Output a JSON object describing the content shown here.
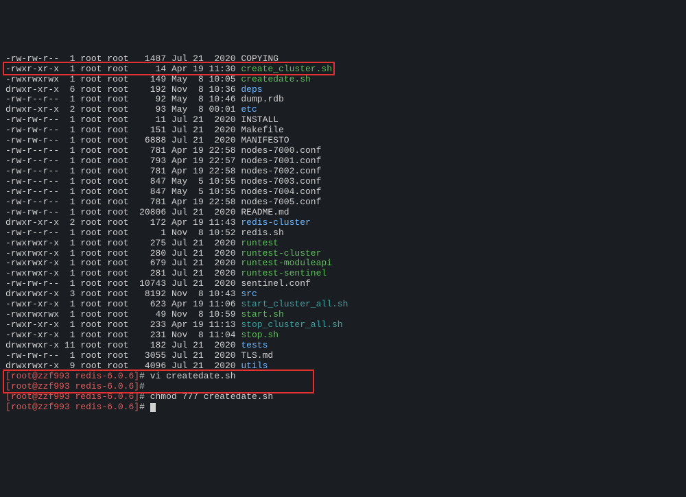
{
  "listing": [
    {
      "perm": "-rw-rw-r--",
      "l": " 1",
      "o": "root",
      "g": "root",
      "sz": "  1487",
      "date": "Jul 21  2020",
      "name": "COPYING",
      "cls": "plain"
    },
    {
      "perm": "-rwxr-xr-x",
      "l": " 1",
      "o": "root",
      "g": "root",
      "sz": "    14",
      "date": "Apr 19 11:30",
      "name": "create_cluster.sh",
      "cls": "exec"
    },
    {
      "perm": "-rwxrwxrwx",
      "l": " 1",
      "o": "root",
      "g": "root",
      "sz": "   149",
      "date": "May  8 10:05",
      "name": "createdate.sh",
      "cls": "exec"
    },
    {
      "perm": "drwxr-xr-x",
      "l": " 6",
      "o": "root",
      "g": "root",
      "sz": "   192",
      "date": "Nov  8 10:36",
      "name": "deps",
      "cls": "dir"
    },
    {
      "perm": "-rw-r--r--",
      "l": " 1",
      "o": "root",
      "g": "root",
      "sz": "    92",
      "date": "May  8 10:46",
      "name": "dump.rdb",
      "cls": "plain"
    },
    {
      "perm": "drwxr-xr-x",
      "l": " 2",
      "o": "root",
      "g": "root",
      "sz": "    93",
      "date": "May  8 00:01",
      "name": "etc",
      "cls": "dir"
    },
    {
      "perm": "-rw-rw-r--",
      "l": " 1",
      "o": "root",
      "g": "root",
      "sz": "    11",
      "date": "Jul 21  2020",
      "name": "INSTALL",
      "cls": "plain"
    },
    {
      "perm": "-rw-rw-r--",
      "l": " 1",
      "o": "root",
      "g": "root",
      "sz": "   151",
      "date": "Jul 21  2020",
      "name": "Makefile",
      "cls": "plain"
    },
    {
      "perm": "-rw-rw-r--",
      "l": " 1",
      "o": "root",
      "g": "root",
      "sz": "  6888",
      "date": "Jul 21  2020",
      "name": "MANIFESTO",
      "cls": "plain"
    },
    {
      "perm": "-rw-r--r--",
      "l": " 1",
      "o": "root",
      "g": "root",
      "sz": "   781",
      "date": "Apr 19 22:58",
      "name": "nodes-7000.conf",
      "cls": "plain"
    },
    {
      "perm": "-rw-r--r--",
      "l": " 1",
      "o": "root",
      "g": "root",
      "sz": "   793",
      "date": "Apr 19 22:57",
      "name": "nodes-7001.conf",
      "cls": "plain"
    },
    {
      "perm": "-rw-r--r--",
      "l": " 1",
      "o": "root",
      "g": "root",
      "sz": "   781",
      "date": "Apr 19 22:58",
      "name": "nodes-7002.conf",
      "cls": "plain"
    },
    {
      "perm": "-rw-r--r--",
      "l": " 1",
      "o": "root",
      "g": "root",
      "sz": "   847",
      "date": "May  5 10:55",
      "name": "nodes-7003.conf",
      "cls": "plain"
    },
    {
      "perm": "-rw-r--r--",
      "l": " 1",
      "o": "root",
      "g": "root",
      "sz": "   847",
      "date": "May  5 10:55",
      "name": "nodes-7004.conf",
      "cls": "plain"
    },
    {
      "perm": "-rw-r--r--",
      "l": " 1",
      "o": "root",
      "g": "root",
      "sz": "   781",
      "date": "Apr 19 22:58",
      "name": "nodes-7005.conf",
      "cls": "plain"
    },
    {
      "perm": "-rw-rw-r--",
      "l": " 1",
      "o": "root",
      "g": "root",
      "sz": " 20806",
      "date": "Jul 21  2020",
      "name": "README.md",
      "cls": "plain"
    },
    {
      "perm": "drwxr-xr-x",
      "l": " 2",
      "o": "root",
      "g": "root",
      "sz": "   172",
      "date": "Apr 19 11:43",
      "name": "redis-cluster",
      "cls": "dir"
    },
    {
      "perm": "-rw-r--r--",
      "l": " 1",
      "o": "root",
      "g": "root",
      "sz": "     1",
      "date": "Nov  8 10:52",
      "name": "redis.sh",
      "cls": "plain"
    },
    {
      "perm": "-rwxrwxr-x",
      "l": " 1",
      "o": "root",
      "g": "root",
      "sz": "   275",
      "date": "Jul 21  2020",
      "name": "runtest",
      "cls": "exec"
    },
    {
      "perm": "-rwxrwxr-x",
      "l": " 1",
      "o": "root",
      "g": "root",
      "sz": "   280",
      "date": "Jul 21  2020",
      "name": "runtest-cluster",
      "cls": "exec"
    },
    {
      "perm": "-rwxrwxr-x",
      "l": " 1",
      "o": "root",
      "g": "root",
      "sz": "   679",
      "date": "Jul 21  2020",
      "name": "runtest-moduleapi",
      "cls": "exec"
    },
    {
      "perm": "-rwxrwxr-x",
      "l": " 1",
      "o": "root",
      "g": "root",
      "sz": "   281",
      "date": "Jul 21  2020",
      "name": "runtest-sentinel",
      "cls": "exec"
    },
    {
      "perm": "-rw-rw-r--",
      "l": " 1",
      "o": "root",
      "g": "root",
      "sz": " 10743",
      "date": "Jul 21  2020",
      "name": "sentinel.conf",
      "cls": "plain"
    },
    {
      "perm": "drwxrwxr-x",
      "l": " 3",
      "o": "root",
      "g": "root",
      "sz": "  8192",
      "date": "Nov  8 10:43",
      "name": "src",
      "cls": "dir"
    },
    {
      "perm": "-rwxr-xr-x",
      "l": " 1",
      "o": "root",
      "g": "root",
      "sz": "   623",
      "date": "Apr 19 11:06",
      "name": "start_cluster_all.sh",
      "cls": "exec-cyan"
    },
    {
      "perm": "-rwxrwxrwx",
      "l": " 1",
      "o": "root",
      "g": "root",
      "sz": "    49",
      "date": "Nov  8 10:59",
      "name": "start.sh",
      "cls": "exec"
    },
    {
      "perm": "-rwxr-xr-x",
      "l": " 1",
      "o": "root",
      "g": "root",
      "sz": "   233",
      "date": "Apr 19 11:13",
      "name": "stop_cluster_all.sh",
      "cls": "exec-cyan"
    },
    {
      "perm": "-rwxr-xr-x",
      "l": " 1",
      "o": "root",
      "g": "root",
      "sz": "   231",
      "date": "Nov  8 11:04",
      "name": "stop.sh",
      "cls": "exec"
    },
    {
      "perm": "drwxrwxr-x",
      "l": "11",
      "o": "root",
      "g": "root",
      "sz": "   182",
      "date": "Jul 21  2020",
      "name": "tests",
      "cls": "dir"
    },
    {
      "perm": "-rw-rw-r--",
      "l": " 1",
      "o": "root",
      "g": "root",
      "sz": "  3055",
      "date": "Jul 21  2020",
      "name": "TLS.md",
      "cls": "plain"
    },
    {
      "perm": "drwxrwxr-x",
      "l": " 9",
      "o": "root",
      "g": "root",
      "sz": "  4096",
      "date": "Jul 21  2020",
      "name": "utils",
      "cls": "dir"
    }
  ],
  "prompts": [
    {
      "user": "root",
      "host": "zzf993",
      "path": "redis-6.0.6",
      "cmd": "vi createdate.sh"
    },
    {
      "user": "root",
      "host": "zzf993",
      "path": "redis-6.0.6",
      "cmd": ""
    },
    {
      "user": "root",
      "host": "zzf993",
      "path": "redis-6.0.6",
      "cmd": "chmod 777 createdate.sh"
    },
    {
      "user": "root",
      "host": "zzf993",
      "path": "redis-6.0.6",
      "cmd": "",
      "cursor": true
    }
  ]
}
